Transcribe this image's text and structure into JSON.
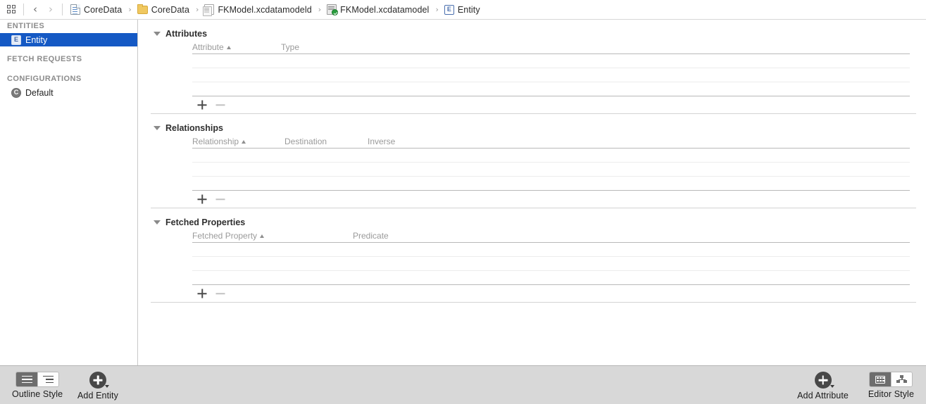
{
  "topbar": {
    "jump_bar_icon": "grid-four-squares-icon",
    "back_label": "‹",
    "forward_label": "›",
    "separator": "›",
    "breadcrumbs": [
      {
        "label": "CoreData",
        "icon": "project-document-icon"
      },
      {
        "label": "CoreData",
        "icon": "folder-icon"
      },
      {
        "label": "FKModel.xcdatamodeld",
        "icon": "xcdatamodeld-icon"
      },
      {
        "label": "FKModel.xcdatamodel",
        "icon": "xcdatamodel-version-icon"
      },
      {
        "label": "Entity",
        "icon": "entity-icon"
      }
    ]
  },
  "sidebar": {
    "groups": [
      {
        "header": "ENTITIES",
        "items": [
          {
            "label": "Entity",
            "icon": "entity-icon",
            "icon_glyph": "E",
            "selected": true
          }
        ]
      },
      {
        "header": "FETCH REQUESTS",
        "items": []
      },
      {
        "header": "CONFIGURATIONS",
        "items": [
          {
            "label": "Default",
            "icon": "configuration-icon",
            "icon_glyph": "C",
            "selected": false
          }
        ]
      }
    ],
    "selection_color": "#1559c4"
  },
  "editor": {
    "sections": [
      {
        "title": "Attributes",
        "expanded": true,
        "columns": [
          "Attribute",
          "Type"
        ],
        "sorted_column": "Attribute",
        "sort_direction": "ascending",
        "rows": [],
        "empty_row_count": 3,
        "add_label": "+",
        "remove_label": "–"
      },
      {
        "title": "Relationships",
        "expanded": true,
        "columns": [
          "Relationship",
          "Destination",
          "Inverse"
        ],
        "sorted_column": "Relationship",
        "sort_direction": "ascending",
        "rows": [],
        "empty_row_count": 3,
        "add_label": "+",
        "remove_label": "–"
      },
      {
        "title": "Fetched Properties",
        "expanded": true,
        "columns": [
          "Fetched Property",
          "Predicate"
        ],
        "sorted_column": "Fetched Property",
        "sort_direction": "ascending",
        "rows": [],
        "empty_row_count": 3,
        "add_label": "+",
        "remove_label": "–"
      }
    ]
  },
  "bottombar": {
    "outline_style": {
      "label": "Outline Style",
      "options": [
        "flat-outline-icon",
        "hierarchical-outline-icon"
      ],
      "selected_index": 0
    },
    "add_entity": {
      "label": "Add Entity",
      "icon": "add-circle-icon",
      "has_menu": true
    },
    "add_attribute": {
      "label": "Add Attribute",
      "icon": "add-circle-icon",
      "has_menu": true
    },
    "editor_style": {
      "label": "Editor Style",
      "options": [
        "table-editor-icon",
        "graph-editor-icon"
      ],
      "selected_index": 0
    }
  }
}
